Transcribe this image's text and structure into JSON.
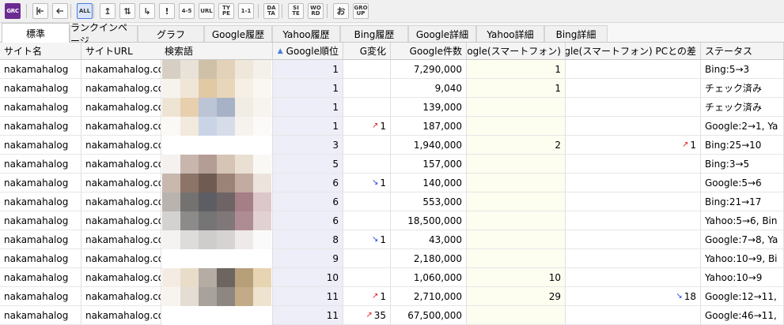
{
  "toolbar": {
    "logo": "GRC",
    "buttons": [
      {
        "name": "first-page-icon",
        "label": ""
      },
      {
        "name": "back-icon",
        "label": ""
      },
      {
        "name": "all-button",
        "label": "ALL"
      },
      {
        "name": "rank-up-button",
        "label": "↥"
      },
      {
        "name": "rank-updown-button",
        "label": "⇅"
      },
      {
        "name": "rank-down-button",
        "label": "↳"
      },
      {
        "name": "alert-button",
        "label": "!"
      },
      {
        "name": "range-button",
        "label": "4-5"
      },
      {
        "name": "url-button",
        "label": "URL"
      },
      {
        "name": "type-button",
        "label": "TYPE"
      },
      {
        "name": "one-one-button",
        "label": "1-1"
      },
      {
        "name": "data-button",
        "label": "DATA"
      },
      {
        "name": "site-button",
        "label": "SITE"
      },
      {
        "name": "word-button",
        "label": "WORD"
      },
      {
        "name": "o-button",
        "label": "お"
      },
      {
        "name": "group-button",
        "label": "GROUP"
      }
    ]
  },
  "tabs": [
    "標準",
    "ランクインページ",
    "グラフ",
    "Google履歴",
    "Yahoo履歴",
    "Bing履歴",
    "Google詳細",
    "Yahoo詳細",
    "Bing詳細"
  ],
  "columns": [
    "サイト名",
    "サイトURL",
    "検索語",
    "Google順位",
    "G変化",
    "Google件数",
    "Google(スマートフォン)",
    "Google(スマートフォン) PCとの差",
    "ステータス"
  ],
  "sort_indicator": "▲",
  "rows": [
    {
      "site": "nakamahalog",
      "url": "nakamahalog.co",
      "rank": "1",
      "change": "",
      "change_dir": "",
      "count": "7,290,000",
      "mobile": "1",
      "diff": "",
      "diff_dir": "",
      "status": "Bing:5→3"
    },
    {
      "site": "nakamahalog",
      "url": "nakamahalog.co",
      "rank": "1",
      "change": "",
      "change_dir": "",
      "count": "9,040",
      "mobile": "1",
      "diff": "",
      "diff_dir": "",
      "status": "チェック済み"
    },
    {
      "site": "nakamahalog",
      "url": "nakamahalog.co",
      "rank": "1",
      "change": "",
      "change_dir": "",
      "count": "139,000",
      "mobile": "",
      "diff": "",
      "diff_dir": "",
      "status": "チェック済み"
    },
    {
      "site": "nakamahalog",
      "url": "nakamahalog.co",
      "rank": "1",
      "change": "1",
      "change_dir": "up",
      "count": "187,000",
      "mobile": "",
      "diff": "",
      "diff_dir": "",
      "status": "Google:2→1, Ya"
    },
    {
      "site": "nakamahalog",
      "url": "nakamahalog.co",
      "rank": "3",
      "change": "",
      "change_dir": "",
      "count": "1,940,000",
      "mobile": "2",
      "diff": "1",
      "diff_dir": "up",
      "status": "Bing:25→10"
    },
    {
      "site": "nakamahalog",
      "url": "nakamahalog.co",
      "rank": "5",
      "change": "",
      "change_dir": "",
      "count": "157,000",
      "mobile": "",
      "diff": "",
      "diff_dir": "",
      "status": "Bing:3→5"
    },
    {
      "site": "nakamahalog",
      "url": "nakamahalog.co",
      "rank": "6",
      "change": "1",
      "change_dir": "down",
      "count": "140,000",
      "mobile": "",
      "diff": "",
      "diff_dir": "",
      "status": "Google:5→6"
    },
    {
      "site": "nakamahalog",
      "url": "nakamahalog.co",
      "rank": "6",
      "change": "",
      "change_dir": "",
      "count": "553,000",
      "mobile": "",
      "diff": "",
      "diff_dir": "",
      "status": "Bing:21→17"
    },
    {
      "site": "nakamahalog",
      "url": "nakamahalog.co",
      "rank": "6",
      "change": "",
      "change_dir": "",
      "count": "18,500,000",
      "mobile": "",
      "diff": "",
      "diff_dir": "",
      "status": "Yahoo:5→6, Bin"
    },
    {
      "site": "nakamahalog",
      "url": "nakamahalog.co",
      "rank": "8",
      "change": "1",
      "change_dir": "down",
      "count": "43,000",
      "mobile": "",
      "diff": "",
      "diff_dir": "",
      "status": "Google:7→8, Ya"
    },
    {
      "site": "nakamahalog",
      "url": "nakamahalog.co",
      "rank": "9",
      "change": "",
      "change_dir": "",
      "count": "2,180,000",
      "mobile": "",
      "diff": "",
      "diff_dir": "",
      "status": "Yahoo:10→9, Bi"
    },
    {
      "site": "nakamahalog",
      "url": "nakamahalog.co",
      "rank": "10",
      "change": "",
      "change_dir": "",
      "count": "1,060,000",
      "mobile": "10",
      "diff": "",
      "diff_dir": "",
      "status": "Yahoo:10→9"
    },
    {
      "site": "nakamahalog",
      "url": "nakamahalog.co",
      "rank": "11",
      "change": "1",
      "change_dir": "up",
      "count": "2,710,000",
      "mobile": "29",
      "diff": "18",
      "diff_dir": "down",
      "status": "Google:12→11,"
    },
    {
      "site": "nakamahalog",
      "url": "nakamahalog.co",
      "rank": "11",
      "change": "35",
      "change_dir": "up",
      "count": "67,500,000",
      "mobile": "",
      "diff": "",
      "diff_dir": "",
      "status": "Google:46→11,"
    }
  ],
  "colors": {
    "accent": "#4a7de0",
    "rank_bg": "#eeeef9",
    "mobile_bg": "#fdfdf0",
    "up": "#e0201f",
    "down": "#1f3ee0",
    "logo_bg": "#6b2c91"
  },
  "icons": {
    "up": "↗",
    "down": "↘"
  }
}
